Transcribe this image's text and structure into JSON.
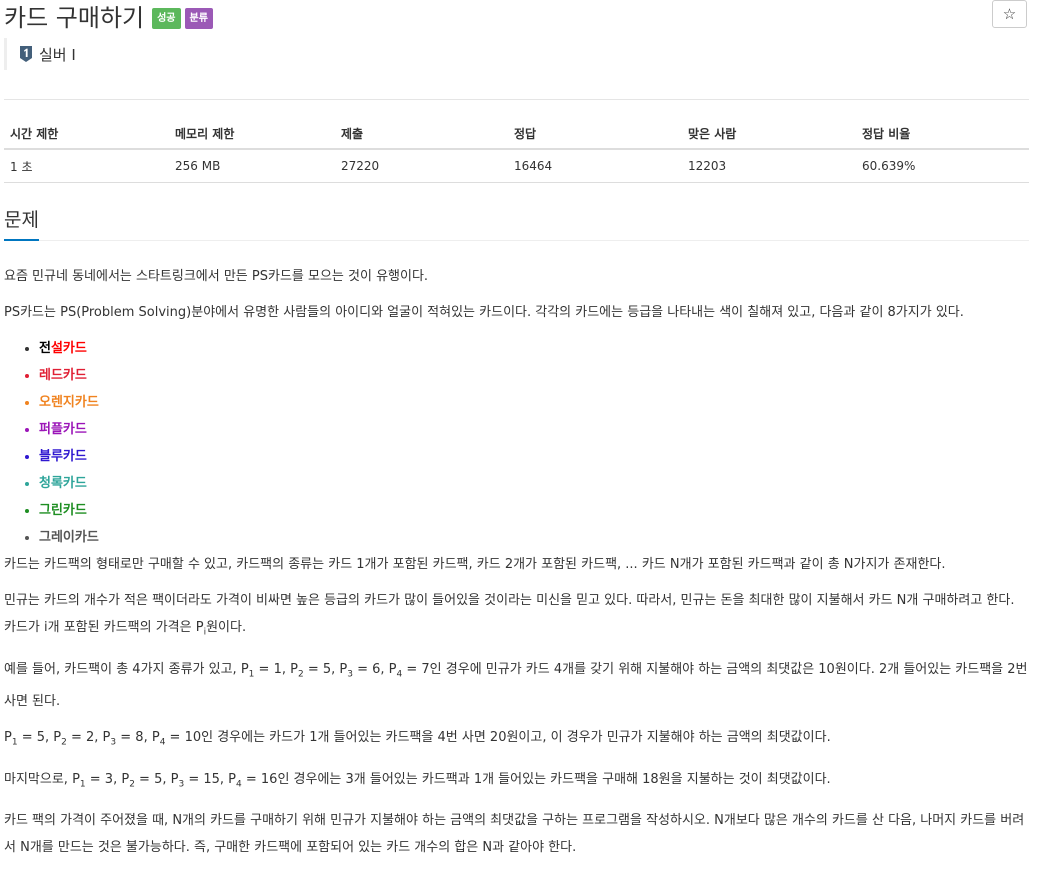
{
  "header": {
    "title": "카드 구매하기",
    "badges": [
      "성공",
      "분류"
    ],
    "star_icon": "star-icon",
    "tier": {
      "icon": "silver-tier-1-icon",
      "label": "실버 I"
    }
  },
  "stats": {
    "headers": [
      "시간 제한",
      "메모리 제한",
      "제출",
      "정답",
      "맞은 사람",
      "정답 비율"
    ],
    "values": [
      "1 초",
      "256 MB",
      "27220",
      "16464",
      "12203",
      "60.639%"
    ]
  },
  "section": {
    "title": "문제"
  },
  "problem": {
    "p1": "요즘 민규네 동네에서는 스타트링크에서 만든 PS카드를 모으는 것이 유행이다.",
    "p2": "PS카드는 PS(Problem Solving)분야에서 유명한 사람들의 아이디와 얼굴이 적혀있는 카드이다. 각각의 카드에는 등급을 나타내는 색이 칠해져 있고, 다음과 같이 8가지가 있다.",
    "cards": {
      "legend_first": "전",
      "legend_rest": "설카드",
      "red": "레드카드",
      "orange": "오렌지카드",
      "purple": "퍼플카드",
      "blue": "블루카드",
      "teal": "청록카드",
      "green": "그린카드",
      "gray": "그레이카드"
    },
    "card_colors": {
      "legend_first": "#000000",
      "legend_rest": "#ff0000",
      "red": "#e01f34",
      "orange": "#f08320",
      "purple": "#9b15b8",
      "blue": "#2f18d0",
      "teal": "#2ea59a",
      "green": "#1e8e22",
      "gray": "#555555"
    },
    "p3": "카드는 카드팩의 형태로만 구매할 수 있고, 카드팩의 종류는 카드 1개가 포함된 카드팩, 카드 2개가 포함된 카드팩, ... 카드 N개가 포함된 카드팩과 같이 총 N가지가 존재한다.",
    "p4_a": "민규는 카드의 개수가 적은 팩이더라도 가격이 비싸면 높은 등급의 카드가 많이 들어있을 것이라는 미신을 믿고 있다. 따라서, 민규는 돈을 최대한 많이 지불해서 카드 N개 구매하려고 한다. 카드가 i개 포함된 카드팩의 가격은 P",
    "p4_sub": "i",
    "p4_b": "원이다.",
    "p5": {
      "pre": "예를 들어, 카드팩이 총 4가지 종류가 있고, P",
      "s1": "1",
      "v1": " = 1, P",
      "s2": "2",
      "v2": " = 5, P",
      "s3": "3",
      "v3": " = 6, P",
      "s4": "4",
      "v4": " = 7인 경우에 민규가 카드 4개를 갖기 위해 지불해야 하는 금액의 최댓값은 10원이다. 2개 들어있는 카드팩을 2번 사면 된다."
    },
    "p6": {
      "pre": "P",
      "s1": "1",
      "v1": " = 5, P",
      "s2": "2",
      "v2": " = 2, P",
      "s3": "3",
      "v3": " = 8, P",
      "s4": "4",
      "v4": " = 10인 경우에는 카드가 1개 들어있는 카드팩을 4번 사면 20원이고, 이 경우가 민규가 지불해야 하는 금액의 최댓값이다."
    },
    "p7": {
      "pre": "마지막으로, P",
      "s1": "1",
      "v1": " = 3, P",
      "s2": "2",
      "v2": " = 5, P",
      "s3": "3",
      "v3": " = 15, P",
      "s4": "4",
      "v4": " = 16인 경우에는 3개 들어있는 카드팩과 1개 들어있는 카드팩을 구매해 18원을 지불하는 것이 최댓값이다."
    },
    "p8": "카드 팩의 가격이 주어졌을 때, N개의 카드를 구매하기 위해 민규가 지불해야 하는 금액의 최댓값을 구하는 프로그램을 작성하시오. N개보다 많은 개수의 카드를 산 다음, 나머지 카드를 버려서 N개를 만드는 것은 불가능하다. 즉, 구매한 카드팩에 포함되어 있는 카드 개수의 합은 N과 같아야 한다."
  }
}
